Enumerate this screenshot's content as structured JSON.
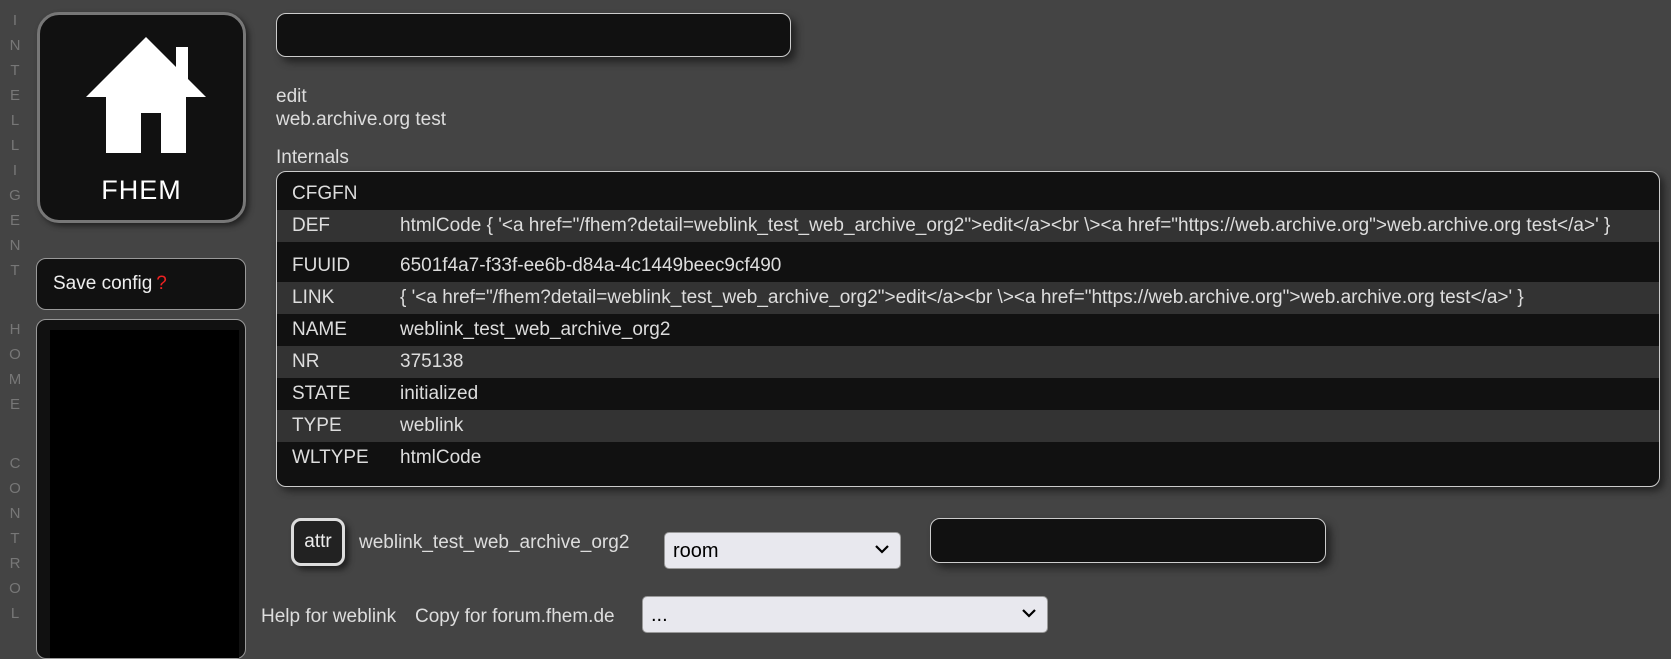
{
  "sidebar": {
    "vertical_text": [
      [
        "I",
        "N",
        "T",
        "E",
        "L",
        "L",
        "I",
        "G",
        "E",
        "N",
        "T"
      ],
      [
        "H",
        "O",
        "M",
        "E"
      ],
      [
        "C",
        "O",
        "N",
        "T",
        "R",
        "O",
        "L"
      ]
    ],
    "logo_text": "FHEM",
    "save_label": "Save config",
    "save_marker": "?"
  },
  "header": {
    "command_input_value": ""
  },
  "detail": {
    "edit_link": "edit",
    "archive_link": "web.archive.org test",
    "internals_title": "Internals",
    "internals": [
      {
        "key": "CFGFN",
        "value": ""
      },
      {
        "key": "DEF",
        "value": "htmlCode { '<a href=\"/fhem?detail=weblink_test_web_archive_org2\">edit</a><br \\><a href=\"https://web.archive.org\">web.archive.org test</a>' }"
      },
      {
        "key": "FUUID",
        "value": "6501f4a7-f33f-ee6b-d84a-4c1449beec9cf490"
      },
      {
        "key": "LINK",
        "value": "{ '<a href=\"/fhem?detail=weblink_test_web_archive_org2\">edit</a><br \\><a href=\"https://web.archive.org\">web.archive.org test</a>' }"
      },
      {
        "key": "NAME",
        "value": "weblink_test_web_archive_org2"
      },
      {
        "key": "NR",
        "value": "375138"
      },
      {
        "key": "STATE",
        "value": "initialized"
      },
      {
        "key": "TYPE",
        "value": "weblink"
      },
      {
        "key": "WLTYPE",
        "value": "htmlCode"
      }
    ]
  },
  "attr": {
    "button_label": "attr",
    "device_name": "weblink_test_web_archive_org2",
    "selected_attr": "room",
    "value_input": ""
  },
  "footer": {
    "help_link": "Help for weblink",
    "copy_label": "Copy for forum.fhem.de",
    "copy_select_value": "..."
  }
}
